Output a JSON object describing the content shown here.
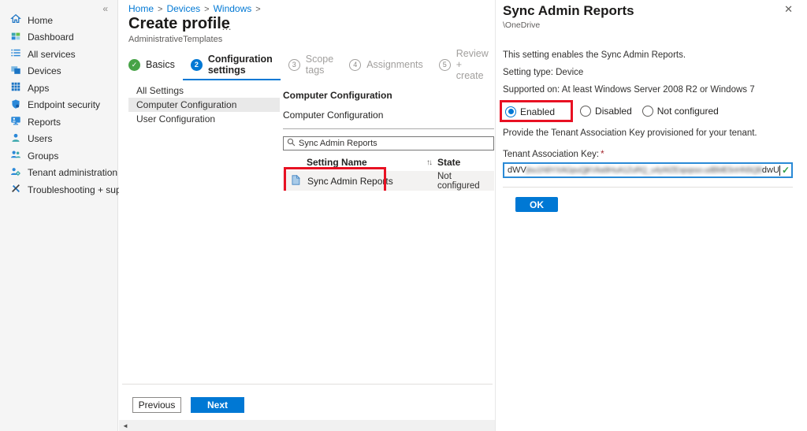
{
  "colors": {
    "accent": "#0078d4",
    "annotation_red": "#e81123",
    "step_complete_green": "#47a347",
    "validation_green": "#2f9e44",
    "selected_row_bg": "#f3f2f1"
  },
  "sidebar": {
    "collapse_icon": "«",
    "items": [
      {
        "label": "Home",
        "icon": "home-icon"
      },
      {
        "label": "Dashboard",
        "icon": "dashboard-icon"
      },
      {
        "label": "All services",
        "icon": "all-services-icon"
      },
      {
        "label": "Devices",
        "icon": "devices-icon"
      },
      {
        "label": "Apps",
        "icon": "apps-icon"
      },
      {
        "label": "Endpoint security",
        "icon": "endpoint-security-icon"
      },
      {
        "label": "Reports",
        "icon": "reports-icon"
      },
      {
        "label": "Users",
        "icon": "users-icon"
      },
      {
        "label": "Groups",
        "icon": "groups-icon"
      },
      {
        "label": "Tenant administration",
        "icon": "tenant-administration-icon"
      },
      {
        "label": "Troubleshooting + support",
        "icon": "troubleshooting-icon"
      }
    ]
  },
  "breadcrumb": {
    "links": [
      "Home",
      "Devices",
      "Windows"
    ],
    "separator": ">"
  },
  "header": {
    "title": "Create profile",
    "more_icon": "…",
    "subtitle": "AdministrativeTemplates"
  },
  "steps": {
    "items": [
      {
        "indicator": "✓",
        "label": "Basics",
        "state": "complete"
      },
      {
        "indicator": "2",
        "label": "Configuration settings",
        "state": "active"
      },
      {
        "indicator": "3",
        "label": "Scope tags",
        "state": "upcoming"
      },
      {
        "indicator": "4",
        "label": "Assignments",
        "state": "upcoming"
      },
      {
        "indicator": "5",
        "label": "Review + create",
        "state": "upcoming"
      }
    ]
  },
  "settings_nav": {
    "items": [
      {
        "label": "All Settings",
        "selected": false
      },
      {
        "label": "Computer Configuration",
        "selected": true
      },
      {
        "label": "User Configuration",
        "selected": false
      }
    ]
  },
  "configuration": {
    "heading": "Computer Configuration",
    "group_label": "Computer Configuration",
    "search": {
      "value": "Sync Admin Reports"
    },
    "table": {
      "columns": [
        {
          "label": "Setting Name",
          "sort_icon": "↑↓"
        },
        {
          "label": "State",
          "sort_icon": "↑↓"
        }
      ],
      "rows": [
        {
          "setting_name": "Sync Admin Reports",
          "state": "Not configured",
          "selected": true
        }
      ]
    }
  },
  "footer": {
    "previous_label": "Previous",
    "next_label": "Next",
    "scroll_left_icon": "◄"
  },
  "detail_panel": {
    "title": "Sync Admin Reports",
    "close_icon": "✕",
    "path": "\\OneDrive",
    "description": "This setting enables the Sync Admin Reports.",
    "setting_type": "Setting type: Device",
    "supported_on": "Supported on: At least Windows Server 2008 R2 or Windows 7",
    "options": [
      {
        "label": "Enabled",
        "selected": true
      },
      {
        "label": "Disabled",
        "selected": false
      },
      {
        "label": "Not configured",
        "selected": false
      }
    ],
    "instruction": "Provide the Tenant Association Key provisioned for your tenant.",
    "field_label": "Tenant Association Key:",
    "required_mark": "*",
    "key_value_prefix": "dWV",
    "key_value_redacted": "jIsu1N9YXAGpuQjKVka9HuA1ZuRQ_u4yWZEspqsso.udBME5nHN5QBnN0aT7sC.dBbo3b",
    "key_value_suffix": "dwU",
    "validation_icon": "✓",
    "ok_label": "OK"
  }
}
